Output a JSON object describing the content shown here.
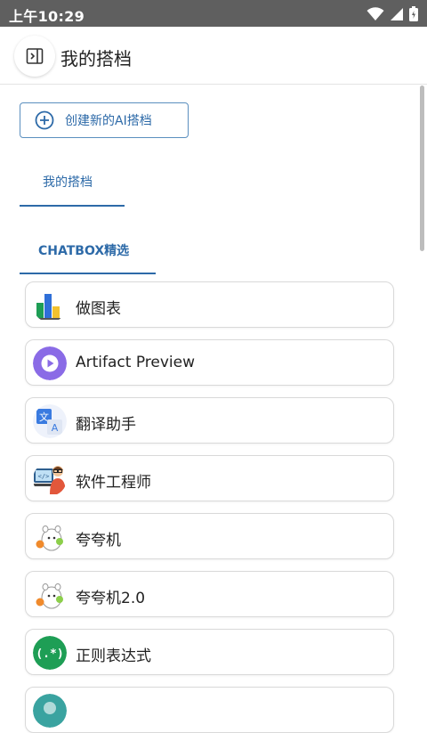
{
  "status_bar": {
    "time": "上午10:29",
    "icons": [
      "wifi-icon",
      "signal-icon",
      "battery-icon"
    ]
  },
  "header": {
    "title": "我的搭档",
    "toggle_icon": "sidebar-toggle-icon"
  },
  "create_button": {
    "label": "创建新的AI搭档",
    "icon": "plus-circle-icon"
  },
  "tabs": [
    {
      "label": "我的搭档"
    },
    {
      "label": "CHATBOX精选"
    }
  ],
  "copilots": [
    {
      "name": "做图表",
      "icon": "bar-chart-icon"
    },
    {
      "name": "Artifact Preview",
      "icon": "play-icon"
    },
    {
      "name": "翻译助手",
      "icon": "translate-icon"
    },
    {
      "name": "软件工程师",
      "icon": "software-engineer-icon"
    },
    {
      "name": "夸夸机",
      "icon": "cartoon-avatar-icon"
    },
    {
      "name": "夸夸机2.0",
      "icon": "cartoon-avatar-icon"
    },
    {
      "name": "正则表达式",
      "icon": "regex-icon"
    },
    {
      "name": "",
      "icon": "teal-avatar-icon"
    }
  ],
  "colors": {
    "accent": "#2d6aa8",
    "status_bar": "#5f5f5f",
    "regex_green": "#1e9e55",
    "artifact_purple": "#8a6be6"
  }
}
